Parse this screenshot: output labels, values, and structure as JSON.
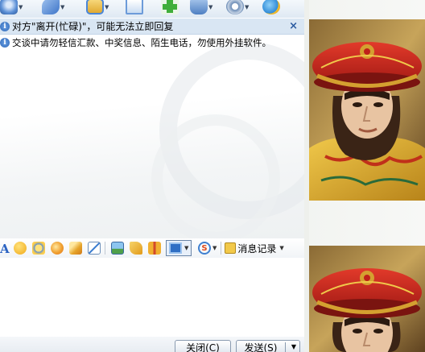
{
  "toolbar": {
    "icons": [
      {
        "name": "video-call-icon",
        "color": "#5b8fd6"
      },
      {
        "name": "voice-call-icon",
        "color": "#3d74c8"
      },
      {
        "name": "send-file-icon",
        "color": "#4a86d8"
      },
      {
        "name": "send-email-icon",
        "color": "#6c9bd9"
      },
      {
        "name": "create-group-icon",
        "color": "#3fae3a"
      },
      {
        "name": "remote-assist-icon",
        "color": "#4e7fc2"
      },
      {
        "name": "app-settings-icon",
        "color": "#6f8fb8"
      },
      {
        "name": "more-apps-icon",
        "color": "#2e8ad8"
      }
    ]
  },
  "notice": {
    "text": "对方\"离开(忙碌)\"，可能无法立即回复",
    "close_glyph": "×"
  },
  "warning": {
    "text": "交谈中请勿轻信汇款、中奖信息、陌生电话，勿使用外挂软件。"
  },
  "format_toolbar": {
    "font_glyph": "A",
    "s_glyph": "S",
    "message_record_label": "消息记录"
  },
  "buttons": {
    "close": "关闭(C)",
    "send": "发送(S)"
  },
  "colors": {
    "accent": "#2a62c2",
    "notice_bg": "#d9e6f3",
    "hat_red": "#c8201c",
    "robe_gold": "#d8a526"
  }
}
